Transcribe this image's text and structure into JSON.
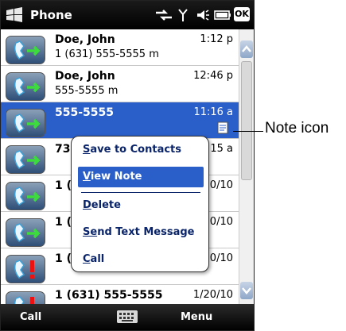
{
  "title_bar": {
    "title": "Phone",
    "ok_label": "OK"
  },
  "call_list": [
    {
      "name": "Doe, John",
      "detail": "1 (631) 555-5555 m",
      "time": "1:12 p",
      "type": "incoming",
      "selected": false
    },
    {
      "name": "Doe, John",
      "detail": "555-5555 m",
      "time": "12:46 p",
      "type": "incoming",
      "selected": false
    },
    {
      "name": "555-5555",
      "detail": "",
      "time": "11:16 a",
      "type": "incoming",
      "selected": true,
      "has_note": true
    },
    {
      "name": "73",
      "detail": "",
      "time": "15 a",
      "type": "incoming",
      "selected": false
    },
    {
      "name": "1 (",
      "detail": "",
      "time": "0/10",
      "type": "incoming",
      "selected": false
    },
    {
      "name": "1 (",
      "detail": "",
      "time": "0/10",
      "type": "incoming",
      "selected": false
    },
    {
      "name": "1 (",
      "detail": "",
      "time": "0/10",
      "type": "missed",
      "selected": false
    },
    {
      "name": "1 (631) 555-5555",
      "detail": "",
      "time": "1/20/10",
      "type": "missed",
      "selected": false
    }
  ],
  "context_menu": {
    "items": [
      {
        "label_ul": "S",
        "label_rest": "ave to Contacts",
        "active": false
      },
      {
        "label_ul": "V",
        "label_rest": "iew Note",
        "active": true
      },
      {
        "label_ul": "D",
        "label_rest": "elete",
        "active": false
      },
      {
        "label_ul": "Se",
        "label_rest": "nd Text Message",
        "active": false
      },
      {
        "label_ul": "C",
        "label_rest": "all",
        "active": false
      }
    ]
  },
  "softkeys": {
    "left": "Call",
    "right": "Menu"
  },
  "callout": {
    "label": "Note icon"
  },
  "icons": {
    "incoming": "phone-green-arrow-icon",
    "missed": "phone-red-exclamation-icon",
    "note": "note-icon",
    "keyboard": "keyboard-icon"
  },
  "colors": {
    "selection": "#2a5ec8",
    "menu_text": "#0a246a"
  }
}
